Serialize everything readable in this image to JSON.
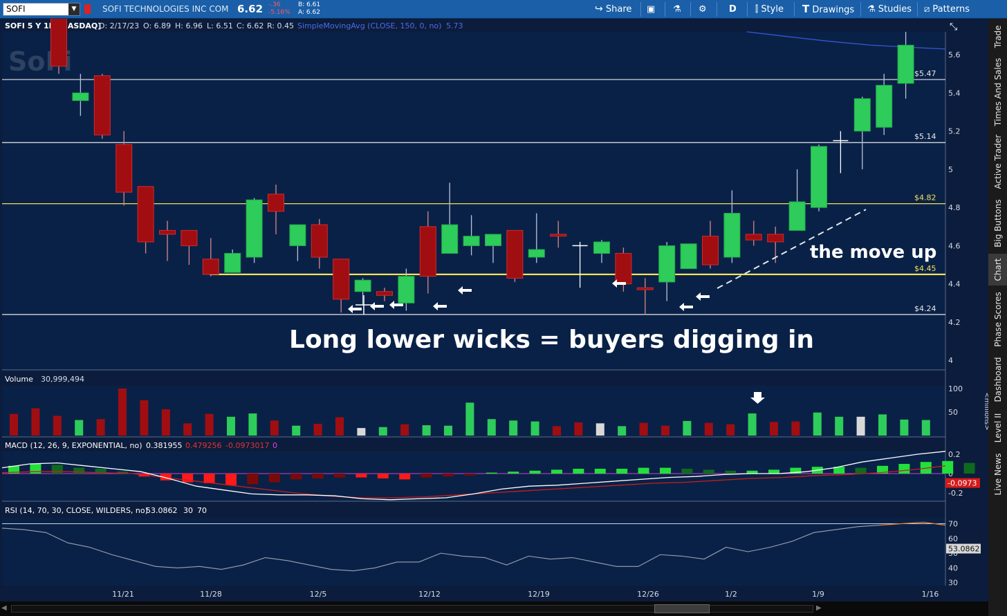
{
  "header": {
    "symbol": "SOFI",
    "company": "SOFI TECHNOLOGIES INC COM",
    "last": "6.62",
    "change": "-.36",
    "change_pct": "-5.16%",
    "bid": "B: 6.61",
    "ask": "A: 6.62",
    "buttons": [
      "Share",
      "D",
      "Style",
      "Drawings",
      "Studies",
      "Patterns"
    ],
    "colors": {
      "bar": "#1a5fa8",
      "negative": "#ff5a5a"
    }
  },
  "sidebar_tabs": [
    "Trade",
    "Times And Sales",
    "Active Trader",
    "Big Buttons",
    "Chart",
    "Phase Scores",
    "Dashboard",
    "Level II",
    "Live News"
  ],
  "price_info": {
    "title": "SOFI 5 Y 1D [NASDAQ]",
    "date": "D: 2/17/23",
    "open": "O: 6.89",
    "high": "H: 6.96",
    "low": "L: 6.51",
    "close": "C: 6.62",
    "range": "R: 0.45",
    "sma_label": "SimpleMovingAvg (CLOSE, 150, 0, no)",
    "sma_value": "5.73",
    "watermark": "SoFi"
  },
  "annotations": {
    "main_text": "Long lower wicks = buyers digging in",
    "move_text": "the move up"
  },
  "chart_data": {
    "type": "candlestick",
    "x_labels": [
      "11/21",
      "11/28",
      "12/5",
      "12/12",
      "12/19",
      "12/26",
      "1/2",
      "1/9",
      "1/16"
    ],
    "candles": [
      {
        "o": 5.8,
        "h": 5.9,
        "l": 5.5,
        "c": 5.54
      },
      {
        "o": 5.36,
        "h": 5.5,
        "l": 5.28,
        "c": 5.4
      },
      {
        "o": 5.49,
        "h": 5.5,
        "l": 5.16,
        "c": 5.18
      },
      {
        "o": 5.13,
        "h": 5.2,
        "l": 4.81,
        "c": 4.88
      },
      {
        "o": 4.91,
        "h": 4.91,
        "l": 4.56,
        "c": 4.62
      },
      {
        "o": 4.68,
        "h": 4.73,
        "l": 4.52,
        "c": 4.66
      },
      {
        "o": 4.68,
        "h": 4.68,
        "l": 4.5,
        "c": 4.6
      },
      {
        "o": 4.53,
        "h": 4.64,
        "l": 4.44,
        "c": 4.45
      },
      {
        "o": 4.46,
        "h": 4.58,
        "l": 4.46,
        "c": 4.56
      },
      {
        "o": 4.54,
        "h": 4.85,
        "l": 4.51,
        "c": 4.84
      },
      {
        "o": 4.87,
        "h": 4.92,
        "l": 4.66,
        "c": 4.78
      },
      {
        "o": 4.6,
        "h": 4.71,
        "l": 4.52,
        "c": 4.71
      },
      {
        "o": 4.71,
        "h": 4.74,
        "l": 4.48,
        "c": 4.54
      },
      {
        "o": 4.53,
        "h": 4.53,
        "l": 4.25,
        "c": 4.32
      },
      {
        "o": 4.36,
        "h": 4.43,
        "l": 4.29,
        "c": 4.42
      },
      {
        "o": 4.36,
        "h": 4.38,
        "l": 4.31,
        "c": 4.34
      },
      {
        "o": 4.3,
        "h": 4.48,
        "l": 4.26,
        "c": 4.44
      },
      {
        "o": 4.44,
        "h": 4.78,
        "l": 4.35,
        "c": 4.7
      },
      {
        "o": 4.56,
        "h": 4.93,
        "l": 4.56,
        "c": 4.71
      },
      {
        "o": 4.6,
        "h": 4.76,
        "l": 4.55,
        "c": 4.65
      },
      {
        "o": 4.6,
        "h": 4.66,
        "l": 4.51,
        "c": 4.66
      },
      {
        "o": 4.68,
        "h": 4.68,
        "l": 4.41,
        "c": 4.43
      },
      {
        "o": 4.54,
        "h": 4.77,
        "l": 4.51,
        "c": 4.58
      },
      {
        "o": 4.66,
        "h": 4.73,
        "l": 4.59,
        "c": 4.65
      },
      {
        "o": 4.6,
        "h": 4.62,
        "l": 4.38,
        "c": 4.6
      },
      {
        "o": 4.56,
        "h": 4.63,
        "l": 4.51,
        "c": 4.62
      },
      {
        "o": 4.56,
        "h": 4.59,
        "l": 4.36,
        "c": 4.4
      },
      {
        "o": 4.38,
        "h": 4.43,
        "l": 4.24,
        "c": 4.37
      },
      {
        "o": 4.41,
        "h": 4.62,
        "l": 4.31,
        "c": 4.6
      },
      {
        "o": 4.48,
        "h": 4.61,
        "l": 4.48,
        "c": 4.61
      },
      {
        "o": 4.65,
        "h": 4.73,
        "l": 4.48,
        "c": 4.5
      },
      {
        "o": 4.54,
        "h": 4.89,
        "l": 4.51,
        "c": 4.77
      },
      {
        "o": 4.66,
        "h": 4.73,
        "l": 4.6,
        "c": 4.63
      },
      {
        "o": 4.66,
        "h": 4.7,
        "l": 4.51,
        "c": 4.62
      },
      {
        "o": 4.68,
        "h": 5.0,
        "l": 4.68,
        "c": 4.83
      },
      {
        "o": 4.8,
        "h": 5.13,
        "l": 4.78,
        "c": 5.12
      },
      {
        "o": 5.15,
        "h": 5.2,
        "l": 4.98,
        "c": 5.15
      },
      {
        "o": 5.2,
        "h": 5.38,
        "l": 5.0,
        "c": 5.37
      },
      {
        "o": 5.22,
        "h": 5.5,
        "l": 5.18,
        "c": 5.44
      },
      {
        "o": 5.45,
        "h": 5.72,
        "l": 5.37,
        "c": 5.65
      }
    ],
    "candle_colors": [
      "down",
      "up",
      "down",
      "down",
      "down",
      "down",
      "down",
      "down",
      "up",
      "up",
      "down",
      "up",
      "down",
      "down",
      "up",
      "down",
      "up",
      "down",
      "up",
      "up",
      "up",
      "down",
      "up",
      "down",
      "doji",
      "up",
      "down",
      "down",
      "up",
      "up",
      "down",
      "up",
      "down",
      "down",
      "up",
      "up",
      "doji",
      "up",
      "up",
      "up"
    ],
    "y_axis": {
      "min": 3.95,
      "max": 5.72,
      "ticks": [
        "4",
        "4.2",
        "4.4",
        "4.6",
        "4.8",
        "5",
        "5.2",
        "5.4",
        "5.6"
      ]
    },
    "levels": [
      {
        "value": 5.47,
        "label": "$5.47",
        "color": "#e8e8e8"
      },
      {
        "value": 5.14,
        "label": "$5.14",
        "color": "#e8e8e8"
      },
      {
        "value": 4.82,
        "label": "$4.82",
        "color": "#f2e25a"
      },
      {
        "value": 4.45,
        "label": "$4.45",
        "color": "#f2e25a"
      },
      {
        "value": 4.24,
        "label": "$4.24",
        "color": "#e8e8e8"
      }
    ],
    "volume": {
      "label": "Volume",
      "value": "30,999,494",
      "unit_label": "<millions>",
      "ticks": [
        "100",
        "50"
      ],
      "ymax": 100,
      "values": [
        46,
        58,
        42,
        33,
        35,
        100,
        75,
        56,
        26,
        46,
        40,
        47,
        32,
        21,
        25,
        39,
        16,
        18,
        24,
        22,
        21,
        70,
        35,
        32,
        30,
        20,
        28,
        26,
        20,
        27,
        21,
        31,
        27,
        24,
        47,
        29,
        30,
        49,
        40,
        40,
        45,
        34,
        33
      ]
    },
    "macd": {
      "label": "MACD (12, 26, 9, EXPONENTIAL, no)",
      "value": "0.381955",
      "avg": "0.479256",
      "diff": "-0.0973017",
      "zero": "0",
      "current_tag": "-0.0973",
      "ticks": [
        "0.2",
        "0",
        "-0.2"
      ],
      "hist": [
        0.08,
        0.1,
        0.09,
        0.06,
        0.05,
        0.02,
        -0.03,
        -0.07,
        -0.09,
        -0.1,
        -0.12,
        -0.11,
        -0.09,
        -0.06,
        -0.05,
        -0.04,
        -0.04,
        -0.05,
        -0.06,
        -0.04,
        -0.03,
        -0.02,
        0.01,
        0.02,
        0.03,
        0.04,
        0.05,
        0.05,
        0.05,
        0.06,
        0.06,
        0.05,
        0.04,
        0.03,
        0.03,
        0.04,
        0.06,
        0.07,
        0.07,
        0.06,
        0.08,
        0.1,
        0.12,
        0.13,
        0.11
      ],
      "macd_line": [
        0.06,
        0.1,
        0.11,
        0.08,
        0.05,
        0.02,
        -0.05,
        -0.13,
        -0.17,
        -0.21,
        -0.22,
        -0.22,
        -0.23,
        -0.26,
        -0.27,
        -0.26,
        -0.25,
        -0.21,
        -0.16,
        -0.13,
        -0.12,
        -0.1,
        -0.08,
        -0.06,
        -0.04,
        -0.03,
        -0.01,
        0.0,
        0.0,
        0.02,
        0.06,
        0.12,
        0.16,
        0.2,
        0.23
      ],
      "signal_line": [
        0.01,
        0.02,
        0.02,
        0.01,
        0.0,
        -0.04,
        -0.08,
        -0.12,
        -0.16,
        -0.2,
        -0.23,
        -0.25,
        -0.25,
        -0.24,
        -0.22,
        -0.2,
        -0.18,
        -0.16,
        -0.14,
        -0.12,
        -0.1,
        -0.09,
        -0.07,
        -0.05,
        -0.04,
        -0.02,
        -0.01,
        0.01,
        0.04,
        0.08
      ]
    },
    "rsi": {
      "label": "RSI (14, 70, 30, CLOSE, WILDERS, no)",
      "value": "53.0862",
      "lo": "30",
      "hi": "70",
      "ticks": [
        "70",
        "60",
        "50",
        "40",
        "30"
      ],
      "values": [
        67,
        66,
        64,
        57,
        54,
        49,
        45,
        41,
        40,
        41,
        39,
        42,
        47,
        45,
        42,
        39,
        38,
        40,
        44,
        44,
        50,
        48,
        47,
        42,
        48,
        46,
        47,
        44,
        41,
        41,
        49,
        48,
        46,
        54,
        51,
        54,
        58,
        64,
        66,
        68,
        69,
        70,
        71,
        69
      ]
    }
  }
}
